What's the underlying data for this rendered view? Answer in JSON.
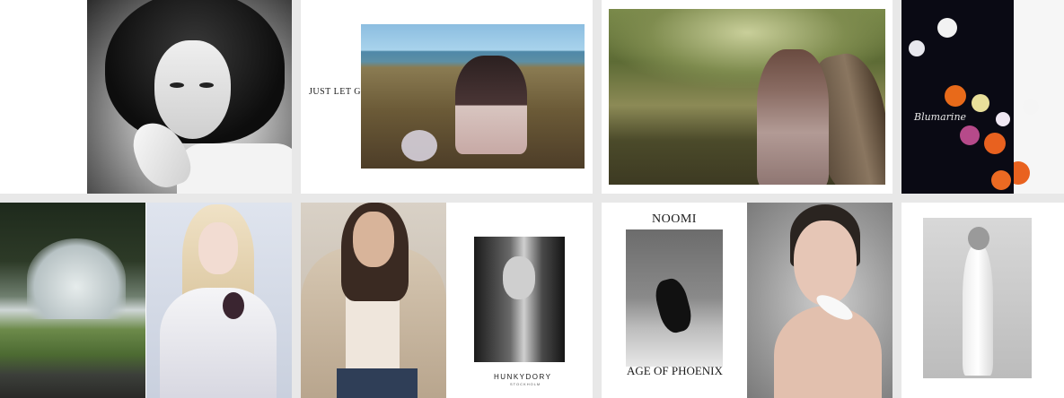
{
  "gallery": {
    "tiles": [
      {
        "name": "banana-portrait"
      },
      {
        "name": "just-let-go",
        "caption": "JUST LET GO"
      },
      {
        "name": "tree-portrait"
      },
      {
        "name": "blumarine-flowers",
        "caption": "Blumarine"
      },
      {
        "name": "park-and-blonde"
      },
      {
        "name": "hunkydory",
        "caption": "HUNKYDORY",
        "subcaption": "STOCKHOLM"
      },
      {
        "name": "noomi",
        "title": "NOOMI",
        "caption": "AGE OF PHOENIX"
      },
      {
        "name": "white-dress"
      }
    ]
  },
  "colors": {
    "page_background": "#e8e8e8",
    "tile_background": "#ffffff"
  }
}
